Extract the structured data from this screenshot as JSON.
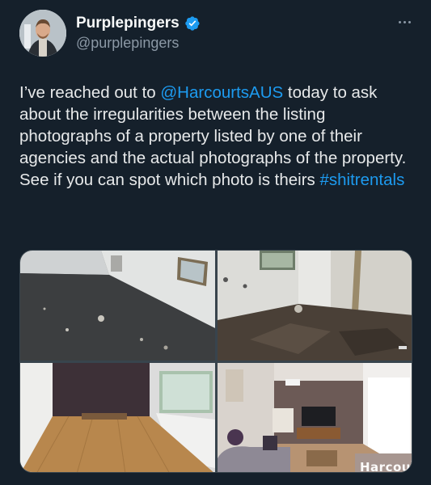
{
  "author": {
    "display_name": "Purplepingers",
    "handle": "@purplepingers",
    "verified": true,
    "verified_color": "#1d9bf0"
  },
  "tweet": {
    "text_before": "I’ve reached out to ",
    "mention": "@HarcourtsAUS",
    "text_middle": " today to ask about the irregularities between the listing photographs of a property listed by one of their agencies and the actual photographs of the property. See if you can spot which photo is theirs ",
    "hashtag": "#shitrentals",
    "link_color": "#1d9bf0"
  },
  "media": {
    "watermark": "Harcou"
  },
  "icons": {
    "more": "more-horizontal-icon",
    "verified": "verified-badge-icon"
  },
  "theme": {
    "background": "#15202b",
    "secondary_text": "#8b98a5"
  }
}
